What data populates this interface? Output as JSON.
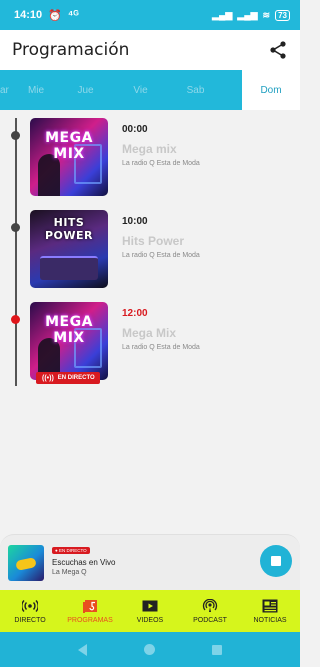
{
  "statusbar": {
    "time": "14:10",
    "network": "⁴ᴳ",
    "battery": "73"
  },
  "appbar": {
    "title": "Programación"
  },
  "tabs": [
    {
      "label": "ar"
    },
    {
      "label": "Mie"
    },
    {
      "label": "Jue"
    },
    {
      "label": "Vie"
    },
    {
      "label": "Sab"
    },
    {
      "label": "Dom",
      "active": true
    }
  ],
  "programs": [
    {
      "time": "00:00",
      "name": "Mega mix",
      "subtitle": "La radio Q Esta de Moda",
      "thumb_logo": "MEGA MIX",
      "live": false
    },
    {
      "time": "10:00",
      "name": "Hits Power",
      "subtitle": "La radio Q Esta de Moda",
      "thumb_logo": "HITS POWER",
      "live": false
    },
    {
      "time": "12:00",
      "name": "Mega Mix",
      "subtitle": "La radio Q Esta de Moda",
      "thumb_logo": "MEGA MIX",
      "live": true,
      "live_badge": "EN DIRECTO"
    }
  ],
  "player": {
    "live_tag": "● EN DIRECTO",
    "title": "Escuchas en Vivo",
    "subtitle": "La Mega Q"
  },
  "bottomnav": [
    {
      "label": "DIRECTO",
      "icon": "broadcast-icon"
    },
    {
      "label": "PROGRAMAS",
      "icon": "programs-icon",
      "active": true
    },
    {
      "label": "VIDEOS",
      "icon": "play-video-icon"
    },
    {
      "label": "PODCAST",
      "icon": "podcast-icon"
    },
    {
      "label": "NOTICIAS",
      "icon": "news-icon"
    }
  ],
  "colors": {
    "accent": "#22b8da",
    "nav_bg": "#d6f51c",
    "live_red": "#d81a20",
    "active_nav": "#e8501f"
  }
}
